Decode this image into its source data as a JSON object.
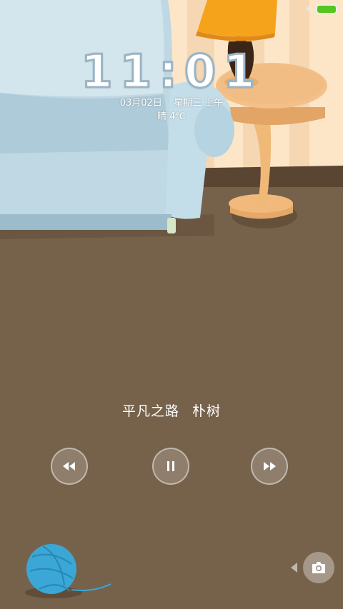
{
  "status_bar": {
    "charging_icon": "bolt-icon",
    "battery_color": "#55c51f"
  },
  "lock": {
    "time": "11:01",
    "date": "03月02日",
    "weekday": "星期三·上午",
    "weather": "晴  4℃"
  },
  "music": {
    "title": "平凡之路",
    "artist": "朴树",
    "controls": {
      "prev_icon": "rewind-icon",
      "pause_icon": "pause-icon",
      "next_icon": "fast-forward-icon"
    }
  },
  "shortcuts": {
    "camera_icon": "camera-icon"
  },
  "colors": {
    "floor": "#76624b",
    "wall": "#fde5c6",
    "sofa": "#b9d6e2",
    "table": "#f0b978",
    "lamp_shade": "#f6a31c",
    "yarn": "#3aa7d6"
  }
}
